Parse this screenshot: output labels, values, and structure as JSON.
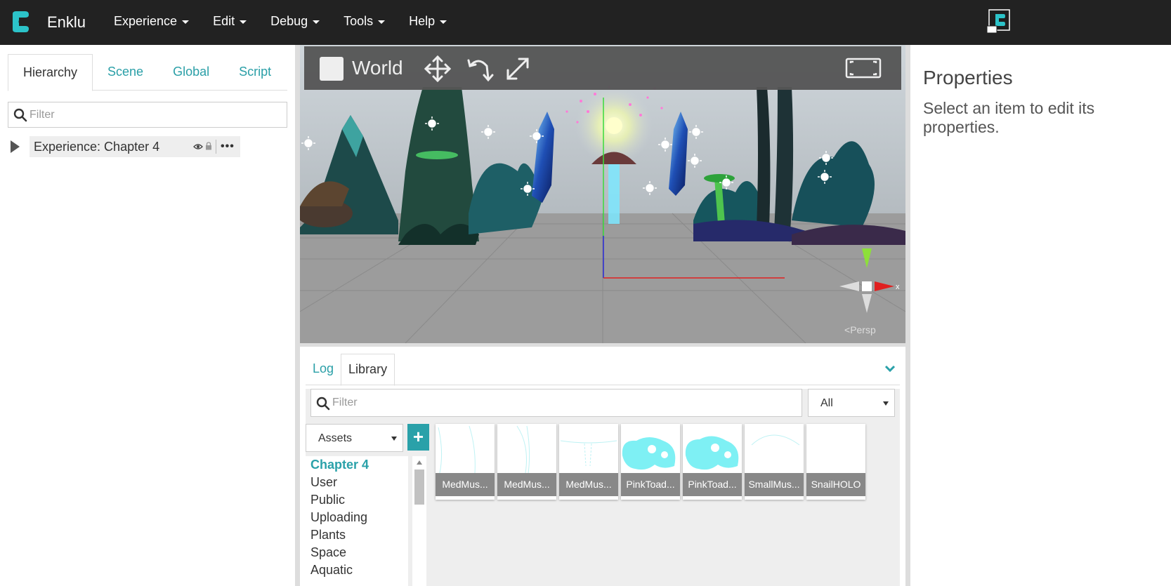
{
  "app": {
    "name": "Enklu"
  },
  "menu": [
    {
      "label": "Experience"
    },
    {
      "label": "Edit"
    },
    {
      "label": "Debug"
    },
    {
      "label": "Tools"
    },
    {
      "label": "Help"
    }
  ],
  "left_panel": {
    "tabs": [
      {
        "label": "Hierarchy",
        "active": true
      },
      {
        "label": "Scene"
      },
      {
        "label": "Global"
      },
      {
        "label": "Script"
      }
    ],
    "filter_placeholder": "Filter",
    "tree_item": "Experience: Chapter 4"
  },
  "viewport": {
    "space_label": "World",
    "camera_label": "Persp"
  },
  "bottom_panel": {
    "tabs": [
      {
        "label": "Log"
      },
      {
        "label": "Library",
        "active": true
      }
    ],
    "filter_placeholder": "Filter",
    "type_select": "All",
    "source_select": "Assets",
    "add_button": "+",
    "folders": [
      "Chapter 4",
      "User",
      "Public",
      "Uploading",
      "Plants",
      "Space",
      "Aquatic"
    ],
    "assets": [
      {
        "label": "MedMus..."
      },
      {
        "label": "MedMus..."
      },
      {
        "label": "MedMus..."
      },
      {
        "label": "PinkToad..."
      },
      {
        "label": "PinkToad..."
      },
      {
        "label": "SmallMus..."
      },
      {
        "label": "SnailHOLO"
      }
    ]
  },
  "properties": {
    "title": "Properties",
    "hint": "Select an item to edit its properties."
  },
  "colors": {
    "accent": "#2aa1a9",
    "topbar": "#222222",
    "hologram": "#7ef0f4"
  }
}
